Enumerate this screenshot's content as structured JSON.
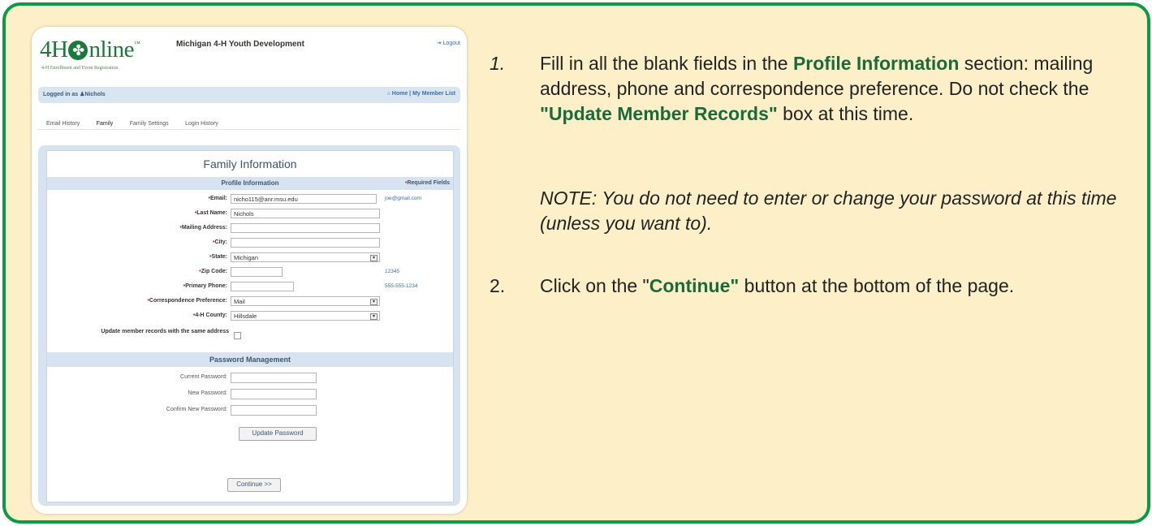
{
  "app": {
    "logo": {
      "pre": "4H",
      "post": "nline",
      "tm": "™",
      "subtitle": "4-H Enrollment and Event Registration"
    },
    "title": "Michigan 4-H Youth Development",
    "logout": "Logout"
  },
  "userbar": {
    "logged_in": "Logged in as",
    "user": "Nichols",
    "home": "Home",
    "member_list": "My Member List"
  },
  "tabs": [
    "Email History",
    "Family",
    "Family Settings",
    "Login History"
  ],
  "family": {
    "title": "Family Information",
    "profile_header": "Profile Information",
    "required_label": "Required Fields",
    "fields": [
      {
        "label": "Email:",
        "value": "nicho115@anr.msu.edu",
        "hint": "joe@gmail.com"
      },
      {
        "label": "Last Name:",
        "value": "Nichols",
        "hint": ""
      },
      {
        "label": "Mailing Address:",
        "value": "",
        "hint": ""
      },
      {
        "label": "City:",
        "value": "",
        "hint": ""
      },
      {
        "label": "State:",
        "value": "Michigan",
        "hint": ""
      },
      {
        "label": "Zip Code:",
        "value": "",
        "hint": "12345"
      },
      {
        "label": "Primary Phone:",
        "value": "",
        "hint": "555-555-1234"
      },
      {
        "label": "Correspondence Preference:",
        "value": "Mail",
        "hint": ""
      },
      {
        "label": "4-H County:",
        "value": "Hillsdale",
        "hint": ""
      }
    ],
    "update_records_label": "Update member records with the same address",
    "password_header": "Password Management",
    "password_fields": [
      "Current Password:",
      "New Password:",
      "Confirm New Password:"
    ],
    "update_password_button": "Update Password",
    "continue_button": "Continue >>"
  },
  "instructions": {
    "step1": {
      "num": "1.",
      "a": "Fill in all the blank fields in the ",
      "b": "Profile Information",
      "c": " section: mailing address, phone and correspondence preference. Do not check the ",
      "d": "\"Update Member Records\"",
      "e": " box at this time."
    },
    "note": "NOTE: You do not need to enter or change your password at this time (unless you want to).",
    "step2": {
      "num": "2.",
      "a": "Click on the \"",
      "b": "Continue\"",
      "c": " button at the bottom of the page."
    }
  },
  "colors": {
    "frame_border": "#0b9a45",
    "frame_bg": "#fdf0c9",
    "accent_green": "#1a6b3a",
    "panel_blue": "#d7e3f0"
  }
}
